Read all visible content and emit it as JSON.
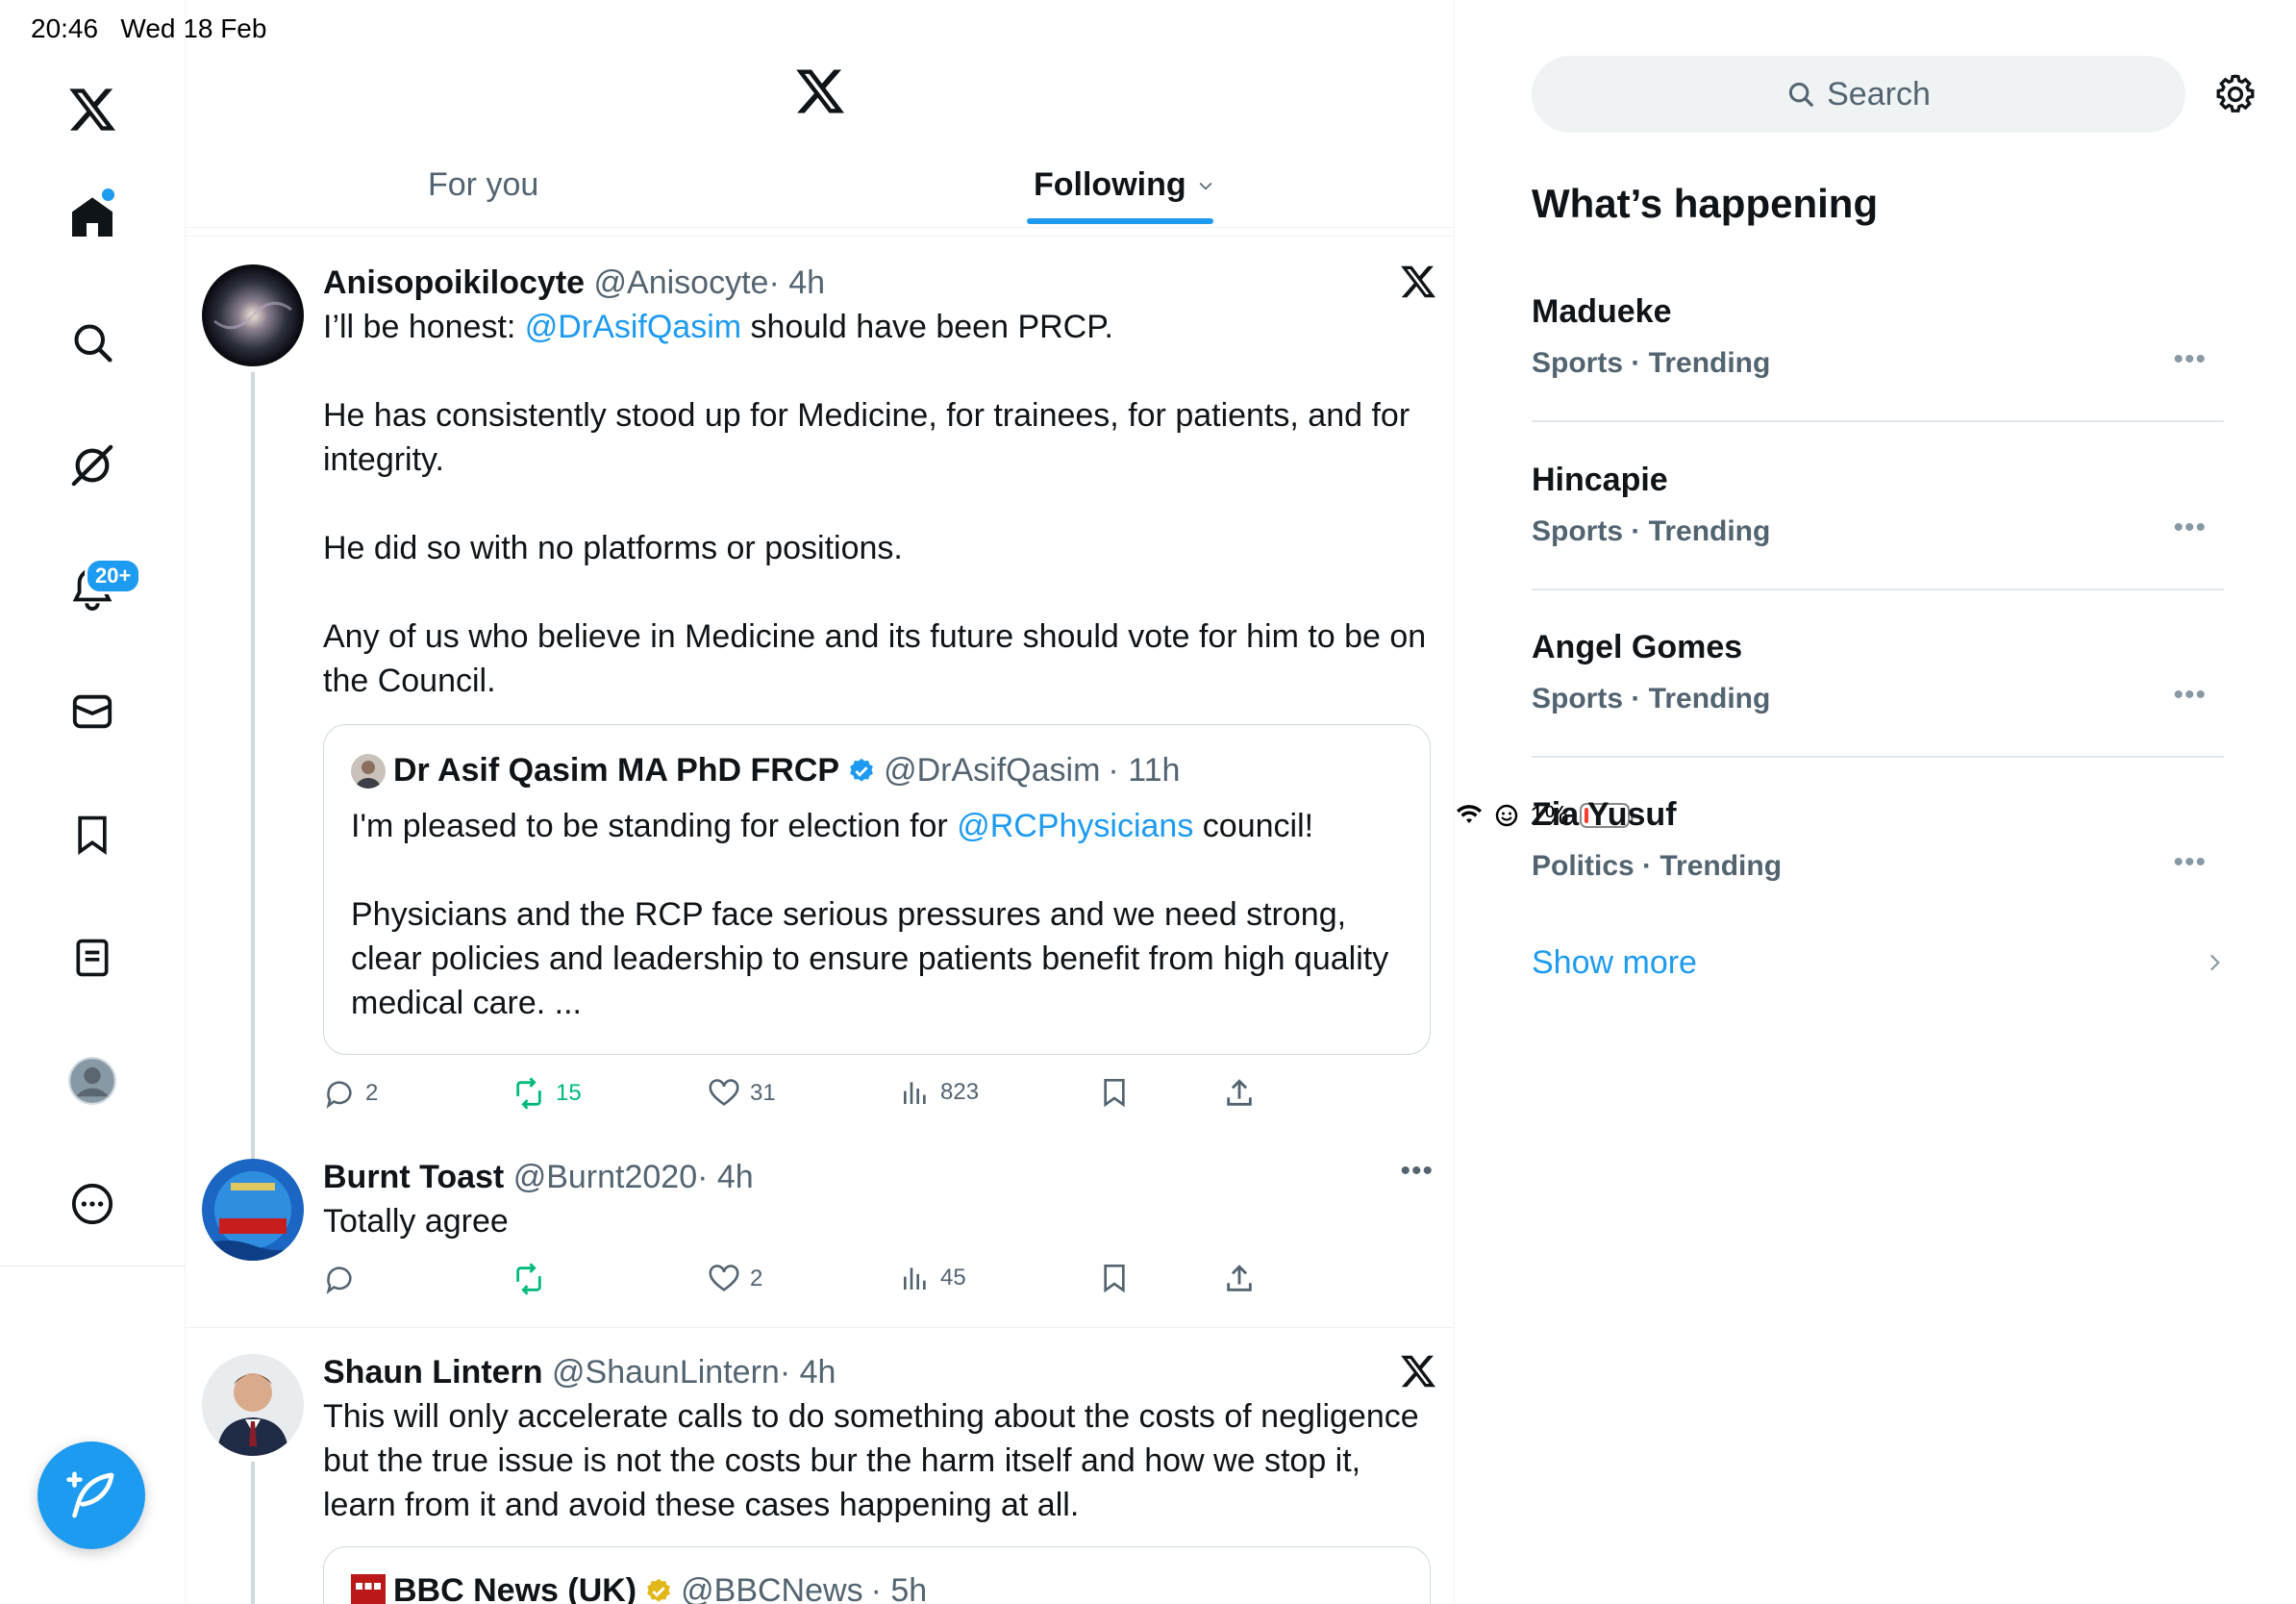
{
  "status_bar": {
    "time": "20:46",
    "date": "Wed 18 Feb",
    "battery": "1%"
  },
  "nav": {
    "items": [
      {
        "name": "x-logo-icon"
      },
      {
        "name": "home-icon"
      },
      {
        "name": "search-icon"
      },
      {
        "name": "grok-icon"
      },
      {
        "name": "notifications-icon"
      },
      {
        "name": "messages-icon"
      },
      {
        "name": "bookmarks-icon"
      },
      {
        "name": "lists-icon"
      },
      {
        "name": "profile-icon"
      },
      {
        "name": "more-icon"
      }
    ],
    "notifications_badge": "20+"
  },
  "tabs": {
    "for_you": "For you",
    "following": "Following"
  },
  "posts": [
    {
      "name": "Anisopoikilocyte",
      "handle": "@Anisocyte",
      "time": "· 4h",
      "text_1_pre": "I’ll be honest: ",
      "text_1_mention": "@DrAsifQasim",
      "text_1_post": " should have been PRCP.",
      "text_2": "He has consistently stood up for Medicine, for trainees, for patients, and for integrity.",
      "text_3": "He did so with no platforms or positions.",
      "text_4": "Any of us who believe in Medicine and its future should vote for him to be on the Council.",
      "quote": {
        "name": "Dr Asif Qasim MA PhD FRCP",
        "handle": "@DrAsifQasim",
        "time": "· 11h",
        "text_1_pre": "I'm pleased to be standing for election for ",
        "text_1_mention": "@RCPhysicians",
        "text_1_post": " council!",
        "text_2": "Physicians and the RCP face serious pressures and we need strong, clear policies and leadership to ensure patients benefit from high quality medical care. ..."
      },
      "replies": "2",
      "reposts": "15",
      "likes": "31",
      "views": "823"
    },
    {
      "name": "Burnt Toast",
      "handle": "@Burnt2020",
      "time": "· 4h",
      "text": "Totally agree",
      "replies": "",
      "reposts": "",
      "likes": "2",
      "views": "45"
    },
    {
      "name": "Shaun Lintern",
      "handle": "@ShaunLintern",
      "time": "· 4h",
      "text": "This will only accelerate calls to do something about the costs of negligence but the true issue is not the costs bur the harm itself and how we stop it, learn from it and avoid these cases happening at all.",
      "quote": {
        "name": "BBC News (UK)",
        "handle": "@BBCNews",
        "time": "· 5h"
      }
    }
  ],
  "sidebar": {
    "search_placeholder": "Search",
    "title": "What’s happening",
    "trends": [
      {
        "name": "Madueke",
        "meta": "Sports · Trending"
      },
      {
        "name": "Hincapie",
        "meta": "Sports · Trending"
      },
      {
        "name": "Angel Gomes",
        "meta": "Sports · Trending"
      },
      {
        "name": "Zia Yusuf",
        "meta": "Politics · Trending"
      }
    ],
    "show_more": "Show more"
  },
  "colors": {
    "accent": "#1d9bf0",
    "repost_green": "#00ba7c",
    "muted": "#536471"
  }
}
